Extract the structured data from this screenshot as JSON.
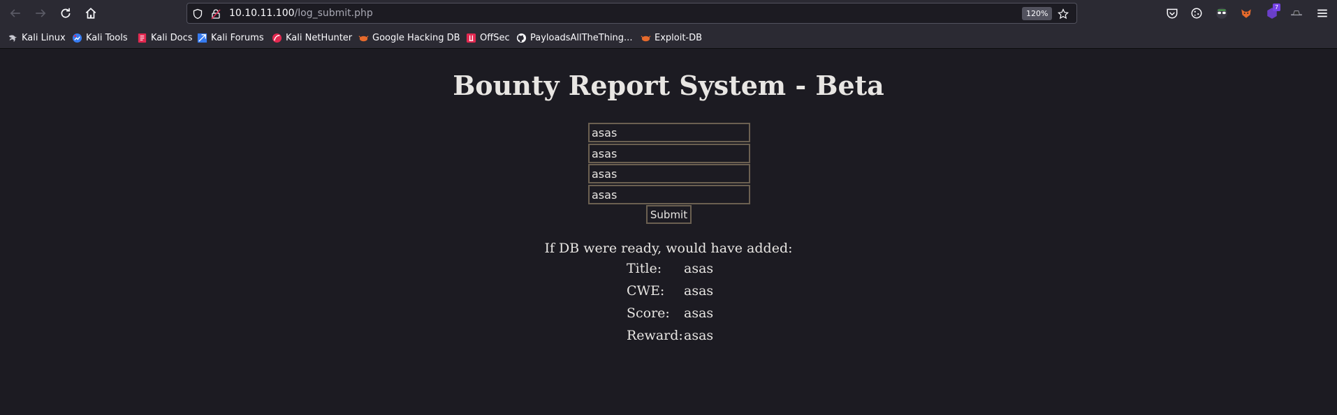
{
  "browser": {
    "url_host": "10.10.11.100",
    "url_path": "/log_submit.php",
    "zoom": "120%",
    "extension_badge": "7"
  },
  "bookmarks": [
    "Kali Linux",
    "Kali Tools",
    "Kali Docs",
    "Kali Forums",
    "Kali NetHunter",
    "Google Hacking DB",
    "OffSec",
    "PayloadsAllTheThing...",
    "Exploit-DB"
  ],
  "page": {
    "title": "Bounty Report System - Beta",
    "fields": [
      "asas",
      "asas",
      "asas",
      "asas"
    ],
    "submit_label": "Submit",
    "result_heading": "If DB were ready, would have added:",
    "results": [
      {
        "label": "Title:",
        "value": "asas"
      },
      {
        "label": "CWE:",
        "value": "asas"
      },
      {
        "label": "Score:",
        "value": "asas"
      },
      {
        "label": "Reward:",
        "value": "asas"
      }
    ]
  },
  "colors": {
    "page_bg": "#1c1b22",
    "chrome_bg": "#2b2a33",
    "text": "#e8e6e3",
    "input_border": "#6b6051"
  }
}
